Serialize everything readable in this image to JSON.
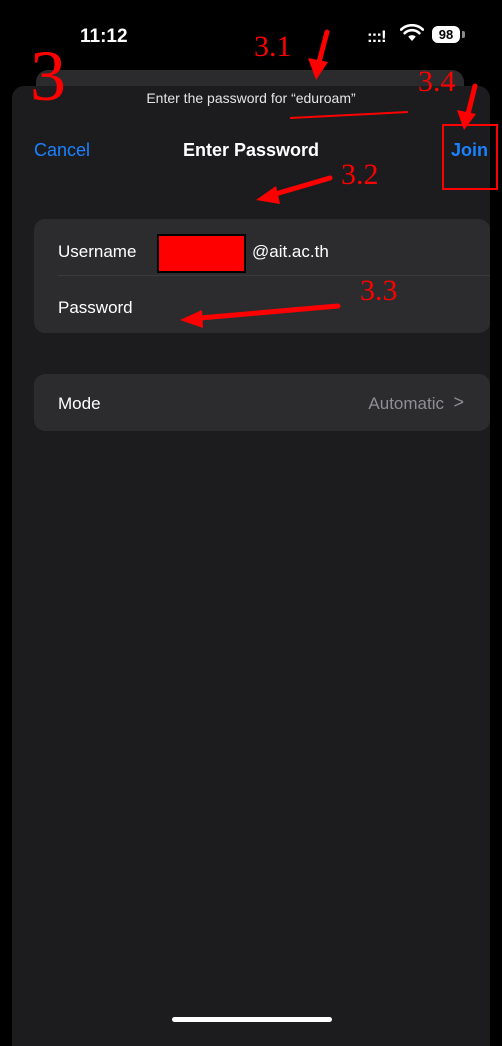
{
  "status_bar": {
    "time": "11:12",
    "signal": ":::!",
    "battery": "98"
  },
  "prompt": "Enter the password for “eduroam”",
  "nav": {
    "cancel": "Cancel",
    "title": "Enter Password",
    "join": "Join"
  },
  "form": {
    "username_label": "Username",
    "username_value": "@ait.ac.th",
    "password_label": "Password",
    "mode_label": "Mode",
    "mode_value": "Automatic",
    "chevron": ">"
  },
  "annotations": {
    "step": "3",
    "a1": "3.1",
    "a2": "3.2",
    "a3": "3.3",
    "a4": "3.4"
  },
  "colors": {
    "accent": "#1a82ff",
    "annotation": "#ff0000",
    "sheet": "#1c1c1e",
    "cell": "#2c2c2e"
  },
  "icons": {
    "wifi": "wifi-icon",
    "battery": "battery-icon",
    "chevron": "chevron-right-icon"
  }
}
